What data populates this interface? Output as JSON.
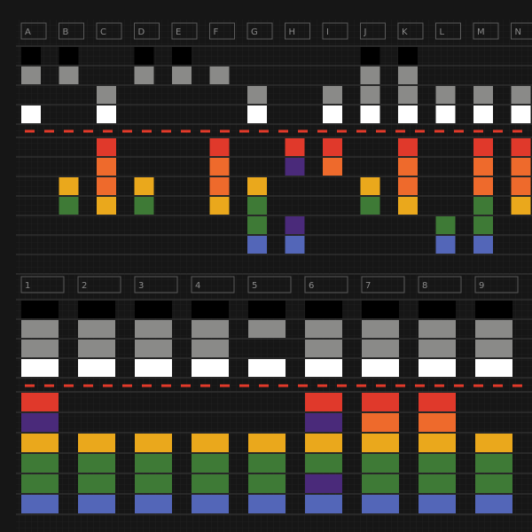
{
  "grid": {
    "top": {
      "headers": [
        "A",
        "B",
        "C",
        "D",
        "E",
        "F",
        "G",
        "H",
        "I",
        "J",
        "K",
        "L",
        "M",
        "N"
      ],
      "columns": [
        {
          "label": "A",
          "upper": [
            "black",
            "gray",
            "",
            "white"
          ],
          "lower": [
            "",
            "",
            "",
            "",
            "",
            "",
            ""
          ]
        },
        {
          "label": "B",
          "upper": [
            "black",
            "gray",
            "",
            ""
          ],
          "lower": [
            "",
            "",
            "yellow",
            "green",
            "",
            "",
            ""
          ]
        },
        {
          "label": "C",
          "upper": [
            "",
            "",
            "gray",
            "white"
          ],
          "lower": [
            "red",
            "orange",
            "orange",
            "yellow",
            "",
            "",
            ""
          ]
        },
        {
          "label": "D",
          "upper": [
            "black",
            "gray",
            "",
            ""
          ],
          "lower": [
            "",
            "",
            "yellow",
            "green",
            "",
            "",
            ""
          ]
        },
        {
          "label": "E",
          "upper": [
            "black",
            "gray",
            "",
            ""
          ],
          "lower": [
            "",
            "",
            "",
            "",
            "",
            "",
            ""
          ]
        },
        {
          "label": "F",
          "upper": [
            "",
            "gray",
            "",
            ""
          ],
          "lower": [
            "red",
            "orange",
            "orange",
            "yellow",
            "",
            "",
            ""
          ]
        },
        {
          "label": "G",
          "upper": [
            "",
            "",
            "gray",
            "white"
          ],
          "lower": [
            "",
            "",
            "yellow",
            "green",
            "green",
            "blue",
            ""
          ]
        },
        {
          "label": "H",
          "upper": [
            "",
            "",
            "",
            ""
          ],
          "lower": [
            "red",
            "purple",
            "",
            "",
            "purple",
            "blue",
            ""
          ]
        },
        {
          "label": "I",
          "upper": [
            "",
            "",
            "gray",
            "white"
          ],
          "lower": [
            "red",
            "orange",
            "",
            "",
            "",
            "",
            ""
          ]
        },
        {
          "label": "J",
          "upper": [
            "black",
            "gray",
            "gray",
            "white"
          ],
          "lower": [
            "",
            "",
            "yellow",
            "green",
            "",
            "",
            ""
          ]
        },
        {
          "label": "K",
          "upper": [
            "black",
            "gray",
            "gray",
            "white"
          ],
          "lower": [
            "red",
            "orange",
            "orange",
            "yellow",
            "",
            "",
            ""
          ]
        },
        {
          "label": "L",
          "upper": [
            "",
            "",
            "gray",
            "white"
          ],
          "lower": [
            "",
            "",
            "",
            "",
            "green",
            "blue",
            ""
          ]
        },
        {
          "label": "M",
          "upper": [
            "",
            "",
            "gray",
            "white"
          ],
          "lower": [
            "red",
            "orange",
            "orange",
            "green",
            "green",
            "blue",
            ""
          ]
        },
        {
          "label": "N",
          "upper": [
            "",
            "",
            "gray",
            "white"
          ],
          "lower": [
            "red",
            "orange",
            "orange",
            "yellow",
            "",
            "",
            ""
          ]
        }
      ]
    },
    "bottom": {
      "headers": [
        "1",
        "2",
        "3",
        "4",
        "5",
        "6",
        "7",
        "8",
        "9"
      ],
      "columns": [
        {
          "label": "1",
          "upper": [
            "black",
            "gray",
            "gray",
            "white"
          ],
          "lower": [
            "red",
            "purple",
            "yellow",
            "green",
            "green",
            "blue",
            ""
          ]
        },
        {
          "label": "2",
          "upper": [
            "black",
            "gray",
            "gray",
            "white"
          ],
          "lower": [
            "",
            "",
            "yellow",
            "green",
            "green",
            "blue",
            ""
          ]
        },
        {
          "label": "3",
          "upper": [
            "black",
            "gray",
            "gray",
            "white"
          ],
          "lower": [
            "",
            "",
            "yellow",
            "green",
            "green",
            "blue",
            ""
          ]
        },
        {
          "label": "4",
          "upper": [
            "black",
            "gray",
            "gray",
            "white"
          ],
          "lower": [
            "",
            "",
            "yellow",
            "green",
            "green",
            "blue",
            ""
          ]
        },
        {
          "label": "5",
          "upper": [
            "black",
            "gray",
            "",
            "white"
          ],
          "lower": [
            "",
            "",
            "yellow",
            "green",
            "green",
            "blue",
            ""
          ]
        },
        {
          "label": "6",
          "upper": [
            "black",
            "gray",
            "gray",
            "white"
          ],
          "lower": [
            "red",
            "purple",
            "yellow",
            "green",
            "purple",
            "blue",
            ""
          ]
        },
        {
          "label": "7",
          "upper": [
            "black",
            "gray",
            "gray",
            "white"
          ],
          "lower": [
            "red",
            "orange",
            "yellow",
            "green",
            "green",
            "blue",
            ""
          ]
        },
        {
          "label": "8",
          "upper": [
            "black",
            "gray",
            "gray",
            "white"
          ],
          "lower": [
            "red",
            "orange",
            "yellow",
            "green",
            "green",
            "blue",
            ""
          ]
        },
        {
          "label": "9",
          "upper": [
            "black",
            "gray",
            "gray",
            "white"
          ],
          "lower": [
            "",
            "",
            "yellow",
            "green",
            "green",
            "blue",
            ""
          ]
        }
      ]
    }
  },
  "colors": {
    "background": "#161616",
    "grid_line": "#3a3a3a",
    "header_box": "#5a5a5a",
    "header_text": "#8a8a8a",
    "dash": "#e23a2a",
    "black": "#000000",
    "gray": "#8a8a88",
    "white": "#ffffff",
    "red": "#e0392b",
    "orange": "#ee6a2c",
    "yellow": "#eaa81c",
    "green": "#3e7a36",
    "blue": "#5366b8",
    "purple": "#4a2a7a"
  }
}
